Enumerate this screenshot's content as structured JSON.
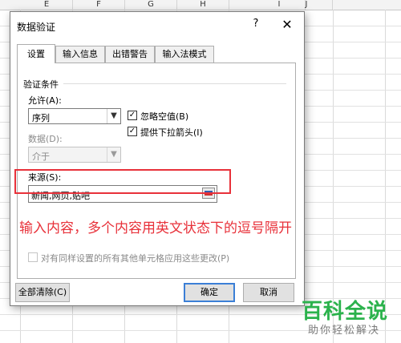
{
  "spreadsheet": {
    "column_headers": [
      "E",
      "F",
      "G",
      "H",
      "I",
      "J"
    ]
  },
  "dialog": {
    "title": "数据验证",
    "help_glyph": "?",
    "close_glyph": "✕",
    "tabs": [
      {
        "label": "设置",
        "active": true
      },
      {
        "label": "输入信息",
        "active": false
      },
      {
        "label": "出错警告",
        "active": false
      },
      {
        "label": "输入法模式",
        "active": false
      }
    ],
    "group_title": "验证条件",
    "allow": {
      "label": "允许(A):",
      "value": "序列"
    },
    "data": {
      "label": "数据(D):",
      "value": "介于",
      "disabled": true
    },
    "ignore_blank": {
      "label": "忽略空值(B)",
      "checked": true
    },
    "in_cell_dropdown": {
      "label": "提供下拉箭头(I)",
      "checked": true
    },
    "source": {
      "label": "来源(S):",
      "value": "新闻,网页,贴吧"
    },
    "apply_all": {
      "label": "对有同样设置的所有其他单元格应用这些更改(P)",
      "checked": false,
      "disabled": true
    },
    "buttons": {
      "clear_all": "全部清除(C)",
      "ok": "确定",
      "cancel": "取消"
    }
  },
  "annotation": {
    "text": "输入内容，多个内容用英文状态下的逗号隔开",
    "color": "#e8313a"
  },
  "watermark": {
    "title": "百科全说",
    "subtitle": "助你轻松解决",
    "color": "#2bb24c"
  }
}
